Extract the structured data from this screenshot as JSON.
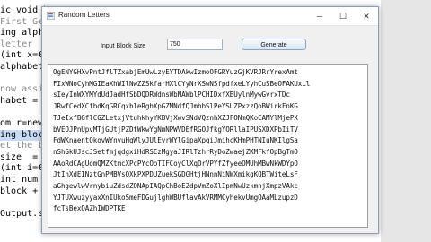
{
  "editor": {
    "lines": [
      {
        "text": "ic void b",
        "kind": "code"
      },
      {
        "text": "First Gen",
        "kind": "comment"
      },
      {
        "text": "ing alpha",
        "kind": "code"
      },
      {
        "text": "letter",
        "kind": "comment"
      },
      {
        "text": "(int x=0",
        "kind": "code"
      },
      {
        "text": "alphabet",
        "kind": "code"
      },
      {
        "text": "",
        "kind": "code"
      },
      {
        "text": "now assig",
        "kind": "comment"
      },
      {
        "text": "habet = a",
        "kind": "code"
      },
      {
        "text": "",
        "kind": "code"
      },
      {
        "text": "om r=new",
        "kind": "code"
      },
      {
        "text": "ing block",
        "kind": "code"
      },
      {
        "text": "et the bl",
        "kind": "comment"
      },
      {
        "text": "size  =",
        "kind": "code"
      },
      {
        "text": "(int i=0",
        "kind": "code"
      },
      {
        "text": "int num",
        "kind": "code"
      },
      {
        "text": "block +",
        "kind": "code"
      },
      {
        "text": "",
        "kind": "code"
      },
      {
        "text": "Output.se",
        "kind": "code"
      }
    ]
  },
  "window": {
    "title": "Random Letters",
    "controls": {
      "minimize": "─",
      "maximize": "☐",
      "close": "✕"
    }
  },
  "form": {
    "block_size_label": "Input Block Size",
    "block_size_value": "750",
    "generate_label": "Generate"
  },
  "output": {
    "lines": [
      "OgENYGHXvPntJflTZxabjEmUwLzyEYTDAkwIzmoOFGRYuzGjKVRJRrYrexAmt",
      "FIxWNoCyhMGIEaXhWIlNwZZSkfarHXlCYyNrXSwNSfpdfxeLYyhCuSBeOFAKUxLl",
      "sIeyInWXYMYdUdJadHfSbDQDRWdnsWbNAWblPCHIDxfXBUylnMywGvrxTDc",
      "JRwfCedXCfbdKqGRCqxbleRghXpGZMNdfQJmhbSlPeYSUZPxzzQoBWirkFnKG",
      "TJeIxfBGflCGZLetxjVtuhkhyYKBVjXwvSNdVQznhXZJFONmQKoCAMYlMjePX",
      "bVEOJPnUpvMTjGUtjPZDtWkwYgNmNPWVDEfRGOJfkgYORllaIPUSXDXPbIiTV",
      "FdWKnaentOkovWYnvuHqWlyJUlEvrWYlGipaXpqiJmihcKHmPHTNIuNKIlgSa",
      "nShGkUJscJSetfmjqdgxiHdRSEzMgyaJIRlTzhrRyDoZwaejZKMFkfOpBgTmO",
      "AAoRdCAgUomQMZKtmcXPcPYcOoTIFCoyClXqOrVPYfZfyeeOMUhMBwNkWDYpO",
      "JtIhXdEINztGnPMBVsOXkPXPDUZuekSGDGHtjHNnnNiNWXmikgKQBTWiteLsF",
      "aGhgewlwVrnybiuZdsdZQNApIAQpChBoEZdpVmZoXlIpmNwUzkmnjXmpzVAkc",
      "YJTUXwuzyyaxXnIUkoSmeFDGujlghWBUflavAkVRMMCyhekvUmgOAaMLzupzD",
      "fcTsBexQAZhIWDPTKE"
    ]
  },
  "colors": {
    "window_border": "#8aa0b8",
    "button_gradient_top": "#f8fbff",
    "button_gradient_bottom": "#d7e5f4",
    "editor_highlight": "#c6dbf5"
  }
}
